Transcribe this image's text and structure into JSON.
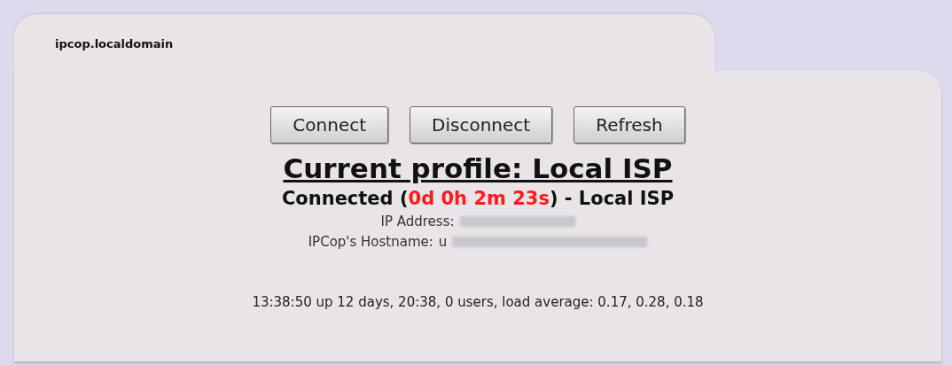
{
  "tab": {
    "title": "ipcop.localdomain"
  },
  "buttons": [
    {
      "label": "Connect"
    },
    {
      "label": "Disconnect"
    },
    {
      "label": "Refresh"
    }
  ],
  "profile": {
    "title": "Current profile: Local ISP"
  },
  "status": {
    "prefix": "Connected (",
    "uptime": "0d 0h 2m 23s",
    "suffix": ") - Local ISP"
  },
  "details": [
    {
      "label": "IP Address:",
      "redacted": true
    },
    {
      "label": "IPCop's Hostname:",
      "value": "u",
      "redacted": true
    }
  ],
  "system_uptime": "13:38:50 up 12 days, 20:38, 0 users, load average: 0.17, 0.28, 0.18"
}
